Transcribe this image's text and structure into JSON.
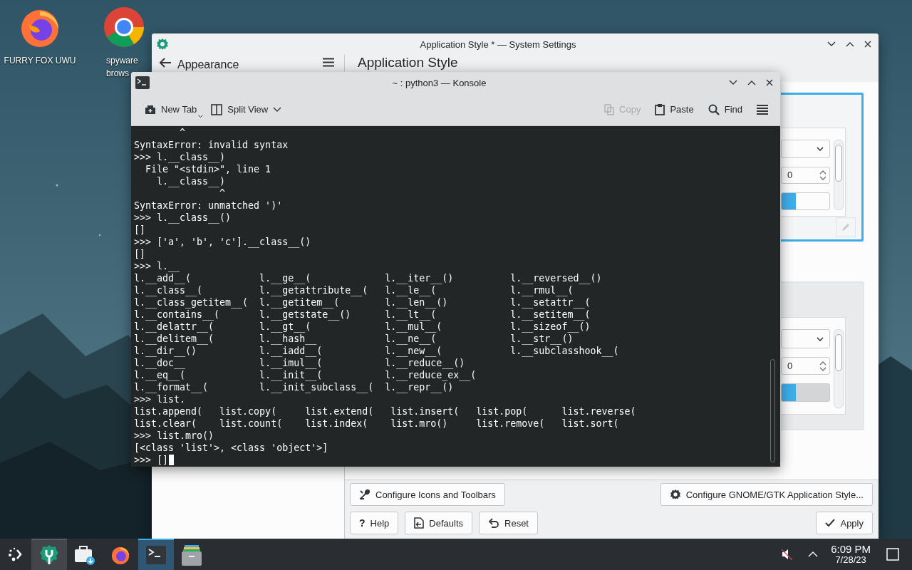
{
  "desktop": {
    "icons": [
      {
        "label": "FURRY FOX UWU",
        "kind": "fox"
      },
      {
        "label": "spyware brows",
        "kind": "ring"
      }
    ]
  },
  "settings_window": {
    "title": "Application Style * — System Settings",
    "sidebar_title": "Appearance",
    "page_title": "Application Style",
    "previews": [
      {
        "selected": true,
        "spin_value": "0",
        "level": 0.3
      },
      {
        "selected": false,
        "spin_value": "0",
        "level": 0.3
      }
    ],
    "buttons_top": [
      {
        "label": "Configure Icons and Toolbars"
      },
      {
        "label": "Configure GNOME/GTK Application Style..."
      }
    ],
    "buttons_bottom": [
      {
        "label": "Help",
        "glyph": "?"
      },
      {
        "label": "Defaults"
      },
      {
        "label": "Reset"
      },
      {
        "label": "Apply"
      }
    ]
  },
  "konsole": {
    "title": "~ : python3 — Konsole",
    "toolbar": [
      {
        "label": "New Tab",
        "kind": "delayed-menu",
        "disabled": false
      },
      {
        "label": "Split View",
        "kind": "menu",
        "disabled": false
      },
      {
        "label": "Copy",
        "kind": "button",
        "disabled": true
      },
      {
        "label": "Paste",
        "kind": "button",
        "disabled": false
      },
      {
        "label": "Find",
        "kind": "button",
        "disabled": false
      }
    ],
    "lines": [
      {
        "kind": "text",
        "text": "        ^"
      },
      {
        "kind": "text",
        "text": "SyntaxError: invalid syntax"
      },
      {
        "kind": "text",
        "text": ">>> l.__class__)"
      },
      {
        "kind": "text",
        "text": "  File \"<stdin>\", line 1"
      },
      {
        "kind": "text",
        "text": "    l.__class__)"
      },
      {
        "kind": "text",
        "text": "               ^"
      },
      {
        "kind": "text",
        "text": "SyntaxError: unmatched ')'"
      },
      {
        "kind": "text",
        "text": ">>> l.__class__()"
      },
      {
        "kind": "text",
        "text": "[]"
      },
      {
        "kind": "text",
        "text": ">>> ['a', 'b', 'c'].__class__()"
      },
      {
        "kind": "text",
        "text": "[]"
      },
      {
        "kind": "text",
        "text": ">>> l.__"
      },
      {
        "kind": "columns",
        "rows": [
          [
            "l.__add__(",
            "l.__ge__(",
            "l.__iter__()",
            "l.__reversed__()"
          ],
          [
            "l.__class__(",
            "l.__getattribute__(",
            "l.__le__(",
            "l.__rmul__("
          ],
          [
            "l.__class_getitem__(",
            "l.__getitem__(",
            "l.__len__()",
            "l.__setattr__("
          ],
          [
            "l.__contains__(",
            "l.__getstate__()",
            "l.__lt__(",
            "l.__setitem__("
          ],
          [
            "l.__delattr__(",
            "l.__gt__(",
            "l.__mul__(",
            "l.__sizeof__()"
          ],
          [
            "l.__delitem__(",
            "l.__hash__",
            "l.__ne__(",
            "l.__str__()"
          ],
          [
            "l.__dir__()",
            "l.__iadd__(",
            "l.__new__(",
            "l.__subclasshook__("
          ],
          [
            "l.__doc__",
            "l.__imul__(",
            "l.__reduce__()"
          ],
          [
            "l.__eq__(",
            "l.__init__(",
            "l.__reduce_ex__("
          ],
          [
            "l.__format__(",
            "l.__init_subclass__(",
            "l.__repr__()"
          ]
        ]
      },
      {
        "kind": "text",
        "text": ">>> list."
      },
      {
        "kind": "columns",
        "rows": [
          [
            "list.append(",
            "list.copy(",
            "list.extend(",
            "list.insert(",
            "list.pop(",
            "list.reverse("
          ],
          [
            "list.clear(",
            "list.count(",
            "list.index(",
            "list.mro()",
            "list.remove(",
            "list.sort("
          ]
        ]
      },
      {
        "kind": "text",
        "text": ">>> list.mro()"
      },
      {
        "kind": "text",
        "text": "[<class 'list'>, <class 'object'>]"
      },
      {
        "kind": "input",
        "text": ">>> []"
      }
    ]
  },
  "taskbar": {
    "tasks": [
      {
        "open": true,
        "selected": false
      },
      {
        "open": false,
        "selected": false
      },
      {
        "open": false,
        "selected": false
      },
      {
        "open": true,
        "selected": true
      },
      {
        "open": false,
        "selected": false
      }
    ],
    "volume": {
      "muted": true
    },
    "clock": {
      "time": "6:09 PM",
      "date": "7/28/23"
    }
  }
}
